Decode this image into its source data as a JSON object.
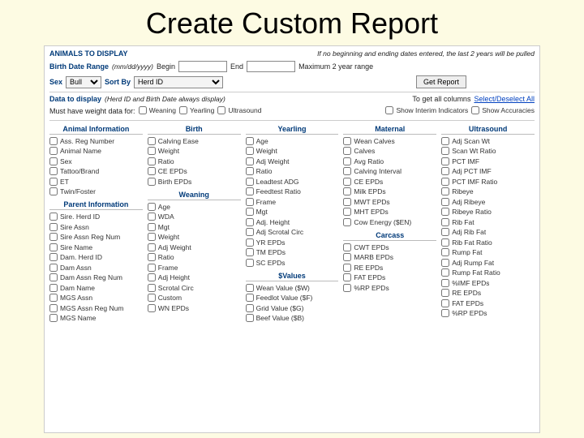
{
  "title": "Create Custom Report",
  "header": {
    "label": "ANIMALS TO DISPLAY",
    "note": "If no beginning and ending dates entered, the last 2 years will be pulled"
  },
  "dateRange": {
    "label": "Birth Date Range",
    "hint": "(mm/dd/yyyy)",
    "beginLabel": "Begin",
    "endLabel": "End",
    "max": "Maximum 2 year range"
  },
  "filters": {
    "sexLabel": "Sex",
    "sexValue": "Bull",
    "sortLabel": "Sort By",
    "sortValue": "Herd ID",
    "button": "Get Report"
  },
  "dataDisplay": {
    "label": "Data to display",
    "hint": "(Herd ID and Birth Date always display)",
    "allLabel": "To get all columns",
    "allLink": "Select/Deselect All"
  },
  "mustHave": {
    "label": "Must have weight data for:",
    "opts": [
      "Weaning",
      "Yearling",
      "Ultrasound"
    ],
    "extra": [
      "Show Interim Indicators",
      "Show Accuracies"
    ]
  },
  "columns": {
    "animal": {
      "head": "Animal Information",
      "items": [
        "Ass. Reg Number",
        "Animal Name",
        "Sex",
        "Tattoo/Brand",
        "ET",
        "Twin/Foster"
      ]
    },
    "parent": {
      "head": "Parent Information",
      "items": [
        "Sire. Herd ID",
        "Sire Assn",
        "Sire Assn Reg Num",
        "Sire Name",
        "Dam. Herd ID",
        "Dam Assn",
        "Dam Assn Reg Num",
        "Dam Name",
        "MGS Assn",
        "MGS Assn Reg Num",
        "MGS Name"
      ]
    },
    "birth": {
      "head": "Birth",
      "items": [
        "Calving Ease",
        "Weight",
        "Ratio",
        "CE EPDs",
        "Birth EPDs"
      ]
    },
    "weaning": {
      "head": "Weaning",
      "items": [
        "Age",
        "WDA",
        "Mgt",
        "Weight",
        "Adj Weight",
        "Ratio",
        "Frame",
        "Adj Height",
        "Scrotal Circ",
        "Custom",
        "WN EPDs"
      ]
    },
    "yearling": {
      "head": "Yearling",
      "items": [
        "Age",
        "Weight",
        "Adj Weight",
        "Ratio",
        "Leadtest ADG",
        "Feedtest Ratio",
        "Frame",
        "Mgt",
        "Adj. Height",
        "Adj Scrotal Circ",
        "YR EPDs",
        "TM EPDs",
        "SC EPDs"
      ]
    },
    "dvalues": {
      "head": "$Values",
      "items": [
        "Wean Value ($W)",
        "Feedlot Value ($F)",
        "Grid Value ($G)",
        "Beef Value ($B)"
      ]
    },
    "maternal": {
      "head": "Maternal",
      "items": [
        "Wean Calves",
        "Calves",
        "Avg Ratio",
        "Calving Interval",
        "CE EPDs",
        "Milk EPDs",
        "MWT EPDs",
        "MHT EPDs",
        "Cow Energy ($EN)"
      ]
    },
    "carcass": {
      "head": "Carcass",
      "items": [
        "CWT EPDs",
        "MARB EPDs",
        "RE EPDs",
        "FAT EPDs",
        "%RP EPDs"
      ]
    },
    "ultrasound": {
      "head": "Ultrasound",
      "items": [
        "Adj Scan Wt",
        "Scan Wt Ratio",
        "PCT IMF",
        "Adj PCT IMF",
        "PCT IMF Ratio",
        "Ribeye",
        "Adj Ribeye",
        "Ribeye Ratio",
        "Rib Fat",
        "Adj Rib Fat",
        "Rib Fat Ratio",
        "Rump Fat",
        "Adj Rump Fat",
        "Rump Fat Ratio",
        "%IMF EPDs",
        "RE EPDs",
        "FAT EPDs",
        "%RP EPDs"
      ]
    }
  }
}
